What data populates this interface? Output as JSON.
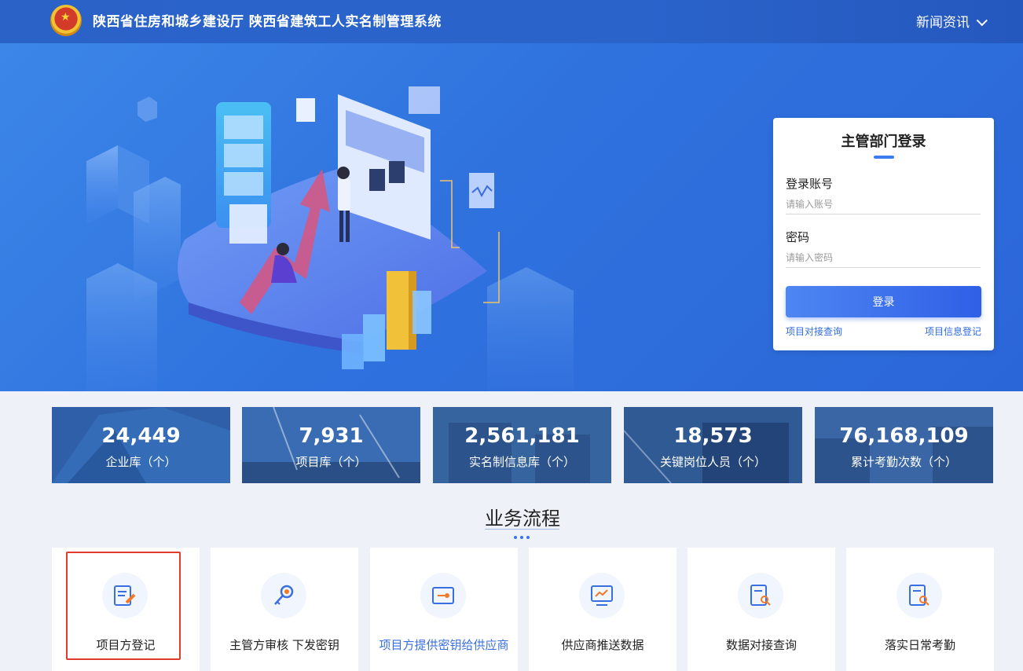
{
  "header": {
    "site_title": "陕西省住房和城乡建设厅   陕西省建筑工人实名制管理系统",
    "news_label": "新闻资讯"
  },
  "login": {
    "title": "主管部门登录",
    "account_label": "登录账号",
    "account_placeholder": "请输入账号",
    "password_label": "密码",
    "password_placeholder": "请输入密码",
    "submit_label": "登录",
    "link_left": "项目对接查询",
    "link_right": "项目信息登记"
  },
  "stats": [
    {
      "value": "24,449",
      "label": "企业库（个）"
    },
    {
      "value": "7,931",
      "label": "项目库（个）"
    },
    {
      "value": "2,561,181",
      "label": "实名制信息库（个）"
    },
    {
      "value": "18,573",
      "label": "关键岗位人员（个）"
    },
    {
      "value": "76,168,109",
      "label": "累计考勤次数（个）"
    }
  ],
  "process": {
    "title": "业务流程",
    "steps": [
      {
        "label": "项目方登记",
        "icon": "edit-doc-icon"
      },
      {
        "label": "主管方审核 下发密钥",
        "icon": "key-icon"
      },
      {
        "label": "项目方提供密钥给供应商",
        "icon": "key-card-icon"
      },
      {
        "label": "供应商推送数据",
        "icon": "monitor-chart-icon"
      },
      {
        "label": "数据对接查询",
        "icon": "doc-search-icon"
      },
      {
        "label": "落实日常考勤",
        "icon": "doc-search-icon"
      }
    ]
  },
  "colors": {
    "brand_blue": "#2a62c8",
    "accent": "#3d7cf0",
    "icon_orange": "#f07a2a",
    "highlight_red": "#e03b2c"
  }
}
